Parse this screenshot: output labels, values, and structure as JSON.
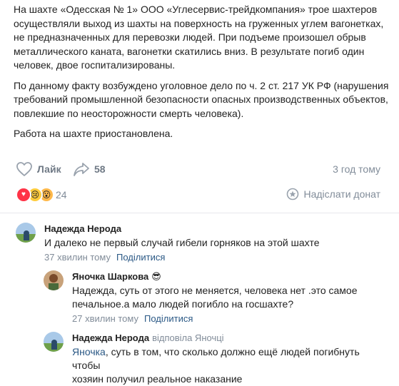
{
  "post": {
    "paragraphs": [
      "На шахте «Одесская № 1» ООО «Углесервис-трейдкомпания» трое шахтеров осуществляли выход из шахты на поверхность на груженных углем вагонетках, не предназначенных для перевозки людей. При подъеме произошел обрыв металлического каната, вагонетки скатились вниз. В результате погиб один человек, двое госпитализированы.",
      "По данному факту возбуждено уголовное дело по ч. 2 ст. 217 УК РФ (нарушения требований промышленной безопасности опасных производственных объектов, повлекшие по неосторожности смерть человека).",
      "Работа на шахте приостановлена."
    ],
    "like_label": "Лайк",
    "share_count": "58",
    "time": "3 год тому",
    "reactions_count": "24",
    "donate_label": "Надіслати донат"
  },
  "icons": {
    "like": "heart-outline-icon",
    "share": "share-arrow-icon",
    "donate": "donate-coin-icon"
  },
  "colors": {
    "link": "#2a5885",
    "meta": "#818c99",
    "heart": "#ff3347"
  },
  "comments": [
    {
      "name": "Надежда Нерода",
      "text": "И далеко не первый случай гибели горняков на этой шахте",
      "time": "37 хвилин тому",
      "share": "Поділитися"
    },
    {
      "name": "Яночка Шаркова",
      "emoji": "😎",
      "text1": "Надежда, суть от этого не меняется, человека нет .это самое",
      "text2": "печальное.а мало людей погибло на госшахте?",
      "time": "27 хвилин тому",
      "share": "Поділитися"
    },
    {
      "name": "Надежда Нерода",
      "replied": "відповіла Яночці",
      "mention": "Яночка",
      "text1_rest": ", суть в том, что сколько должно ещё людей погибнуть чтобы",
      "text2": "хозяин получил реальное наказание"
    }
  ]
}
